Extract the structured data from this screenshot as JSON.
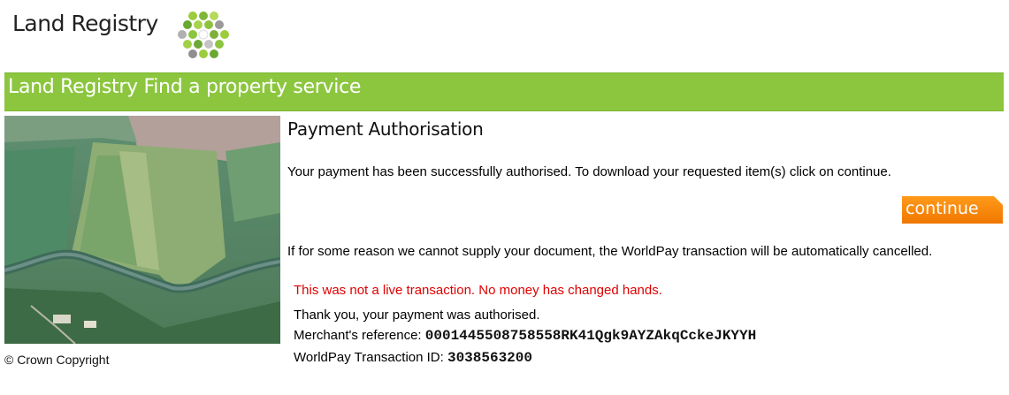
{
  "header": {
    "logo_text": "Land Registry",
    "logo_icon": "hexagon-cluster-logo"
  },
  "banner": {
    "title": "Land Registry Find a property service"
  },
  "sidebar": {
    "image_icon": "aerial-landscape-photo",
    "copyright": "© Crown Copyright"
  },
  "main": {
    "heading": "Payment Authorisation",
    "success_message": "Your payment has been successfully authorised. To download your requested item(s) click on continue.",
    "continue_label": "continue",
    "cancel_message": "If for some reason we cannot supply your document, the WorldPay transaction will be automatically cancelled.",
    "test_notice": "This was not a live transaction. No money has changed hands.",
    "thank_you": "Thank you, your payment was authorised.",
    "merchant_ref_label": "Merchant's reference: ",
    "merchant_ref_value": "0001445508758558RK41Qgk9AYZAkqCckeJKYYH",
    "transaction_id_label": "WorldPay Transaction ID: ",
    "transaction_id_value": "3038563200"
  },
  "colors": {
    "banner_green": "#8cc63f",
    "button_orange": "#f58a0b",
    "notice_red": "#e00000"
  }
}
